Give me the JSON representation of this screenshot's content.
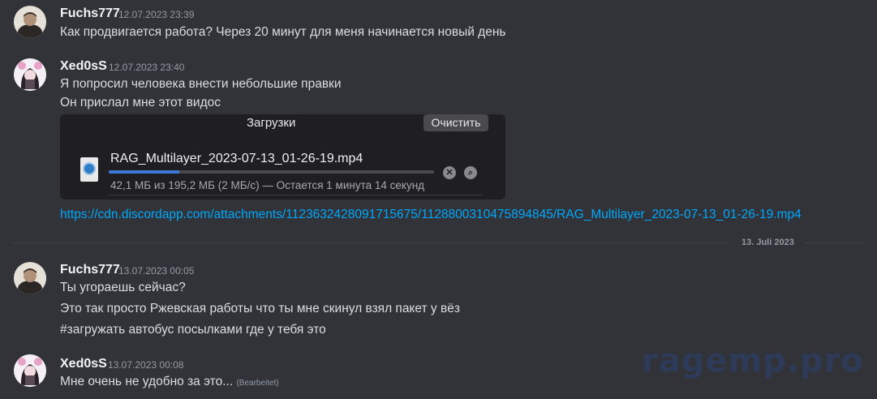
{
  "messages": [
    {
      "author": "Fuchs777",
      "time": "12.07.2023 23:39",
      "lines": [
        "Как продвигается работа? Через 20 минут для меня начинается новый день"
      ]
    },
    {
      "author": "Xed0sS",
      "time": "12.07.2023 23:40",
      "lines": [
        "Я попросил человека внести небольшие правки",
        "Он прислал мне этот видос"
      ],
      "attachment": {
        "title": "Загрузки",
        "clear_button": "Очистить",
        "file_name": "RAG_Multilayer_2023-07-13_01-26-19.mp4",
        "progress_fraction": 0.216,
        "status": "42,1 МБ из 195,2 МБ (2 МБ/с) — Остается 1 минута 14 секунд",
        "icon": "quicktime-file-icon"
      },
      "link": "https://cdn.discordapp.com/attachments/1123632428091715675/1128800310475894845/RAG_Multilayer_2023-07-13_01-26-19.mp4"
    },
    {
      "author": "Fuchs777",
      "time": "13.07.2023 00:05",
      "lines": [
        "Ты угораешь сейчас?",
        "Это так просто Ржевская работы что ты мне скинул взял пакет у вёз",
        "#загружать автобус посылками где у тебя это"
      ]
    },
    {
      "author": "Xed0sS",
      "time": "13.07.2023 00:08",
      "lines": [
        "Мне очень не удобно за это..."
      ],
      "edited": "(Bearbeitet)"
    }
  ],
  "date_divider": "13. Juli 2023",
  "watermark": "ragemp.pro",
  "colors": {
    "background": "#313338",
    "link": "#00a8fc",
    "progress": "#3b78d8"
  }
}
